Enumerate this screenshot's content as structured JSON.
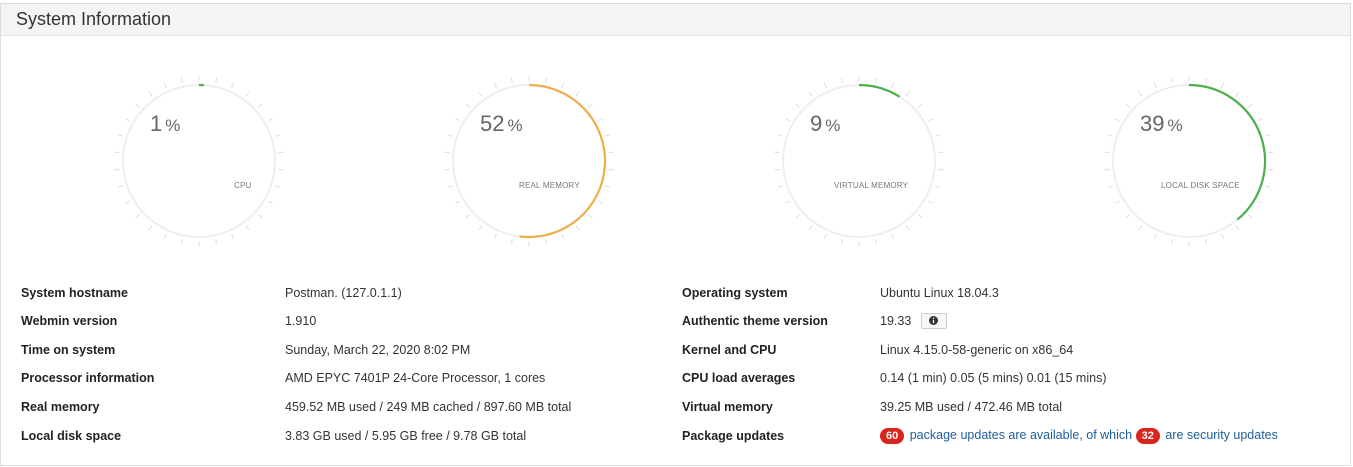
{
  "panel": {
    "title": "System Information"
  },
  "gauges": [
    {
      "value": "1",
      "unit": "%",
      "label": "CPU",
      "percent": 1,
      "color": "#4cb04c"
    },
    {
      "value": "52",
      "unit": "%",
      "label": "REAL MEMORY",
      "percent": 52,
      "color": "#f0ad4e"
    },
    {
      "value": "9",
      "unit": "%",
      "label": "VIRTUAL MEMORY",
      "percent": 9,
      "color": "#4cb04c"
    },
    {
      "value": "39",
      "unit": "%",
      "label": "LOCAL DISK SPACE",
      "percent": 39,
      "color": "#4cb04c"
    }
  ],
  "left_info": [
    {
      "label": "System hostname",
      "value": "Postman. (127.0.1.1)"
    },
    {
      "label": "Webmin version",
      "value": "1.910"
    },
    {
      "label": "Time on system",
      "value": "Sunday, March 22, 2020 8:02 PM"
    },
    {
      "label": "Processor information",
      "value": "AMD EPYC 7401P 24-Core Processor, 1 cores"
    },
    {
      "label": "Real memory",
      "value": "459.52 MB used / 249 MB cached / 897.60 MB total"
    },
    {
      "label": "Local disk space",
      "value": "3.83 GB used / 5.95 GB free / 9.78 GB total"
    }
  ],
  "right_info": {
    "os": {
      "label": "Operating system",
      "value": "Ubuntu Linux 18.04.3"
    },
    "theme": {
      "label": "Authentic theme version",
      "value": "19.33",
      "info_icon": "info-circle-icon"
    },
    "kernel": {
      "label": "Kernel and CPU",
      "value": "Linux 4.15.0-58-generic on x86_64"
    },
    "load": {
      "label": "CPU load averages",
      "value": "0.14 (1 min) 0.05 (5 mins) 0.01 (15 mins)"
    },
    "vmem": {
      "label": "Virtual memory",
      "value": "39.25 MB used / 472.46 MB total"
    },
    "updates": {
      "label": "Package updates",
      "count": "60",
      "text1": "package updates are available, of which",
      "security_count": "32",
      "text2": "are security updates",
      "badge_color": "#d9261c",
      "link_color": "#1f5e9c"
    }
  }
}
